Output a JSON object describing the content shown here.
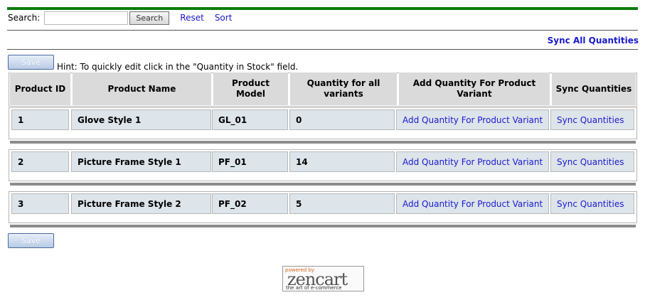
{
  "search": {
    "label": "Search:",
    "value": "",
    "button_label": "Search"
  },
  "links": {
    "reset": "Reset",
    "sort": "Sort",
    "sync_all": "Sync All Quantities"
  },
  "save_label": "Save",
  "hint": "Hint: To quickly edit click in the \"Quantity in Stock\" field.",
  "table": {
    "headers": [
      "Product ID",
      "Product Name",
      "Product Model",
      "Quantity for all variants",
      "Add Quantity For Product Variant",
      "Sync Quantities"
    ],
    "rows": [
      {
        "id": "1",
        "name": "Glove Style 1",
        "model": "GL_01",
        "qty": "0",
        "add_link": "Add Quantity For Product Variant",
        "sync_link": "Sync Quantities"
      },
      {
        "id": "2",
        "name": "Picture Frame Style 1",
        "model": "PF_01",
        "qty": "14",
        "add_link": "Add Quantity For Product Variant",
        "sync_link": "Sync Quantities"
      },
      {
        "id": "3",
        "name": "Picture Frame Style 2",
        "model": "PF_02",
        "qty": "5",
        "add_link": "Add Quantity For Product Variant",
        "sync_link": "Sync Quantities"
      }
    ]
  },
  "logo": {
    "top_text": "powered by",
    "brand": "zencart",
    "tagline": "the art of e-commerce"
  },
  "colors": {
    "accent_green": "#0b7d0b",
    "link": "#1a1acc",
    "cell_bg": "#dde4ea",
    "header_bg": "#dadada"
  }
}
